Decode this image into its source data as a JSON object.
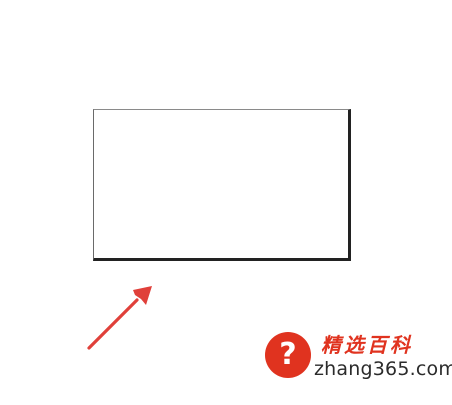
{
  "canvas": {
    "background_color": "#ffffff"
  },
  "rectangle": {
    "fill_color": "#ffffff",
    "border_color": "#222222"
  },
  "arrow": {
    "color": "#e0403a",
    "direction": "up-right",
    "icon": "arrow-icon"
  },
  "watermark": {
    "badge_symbol": "?",
    "brand": "精选百科",
    "domain": "zhang365.com",
    "brand_color": "#e0331f",
    "domain_color": "#2b2b2b"
  }
}
